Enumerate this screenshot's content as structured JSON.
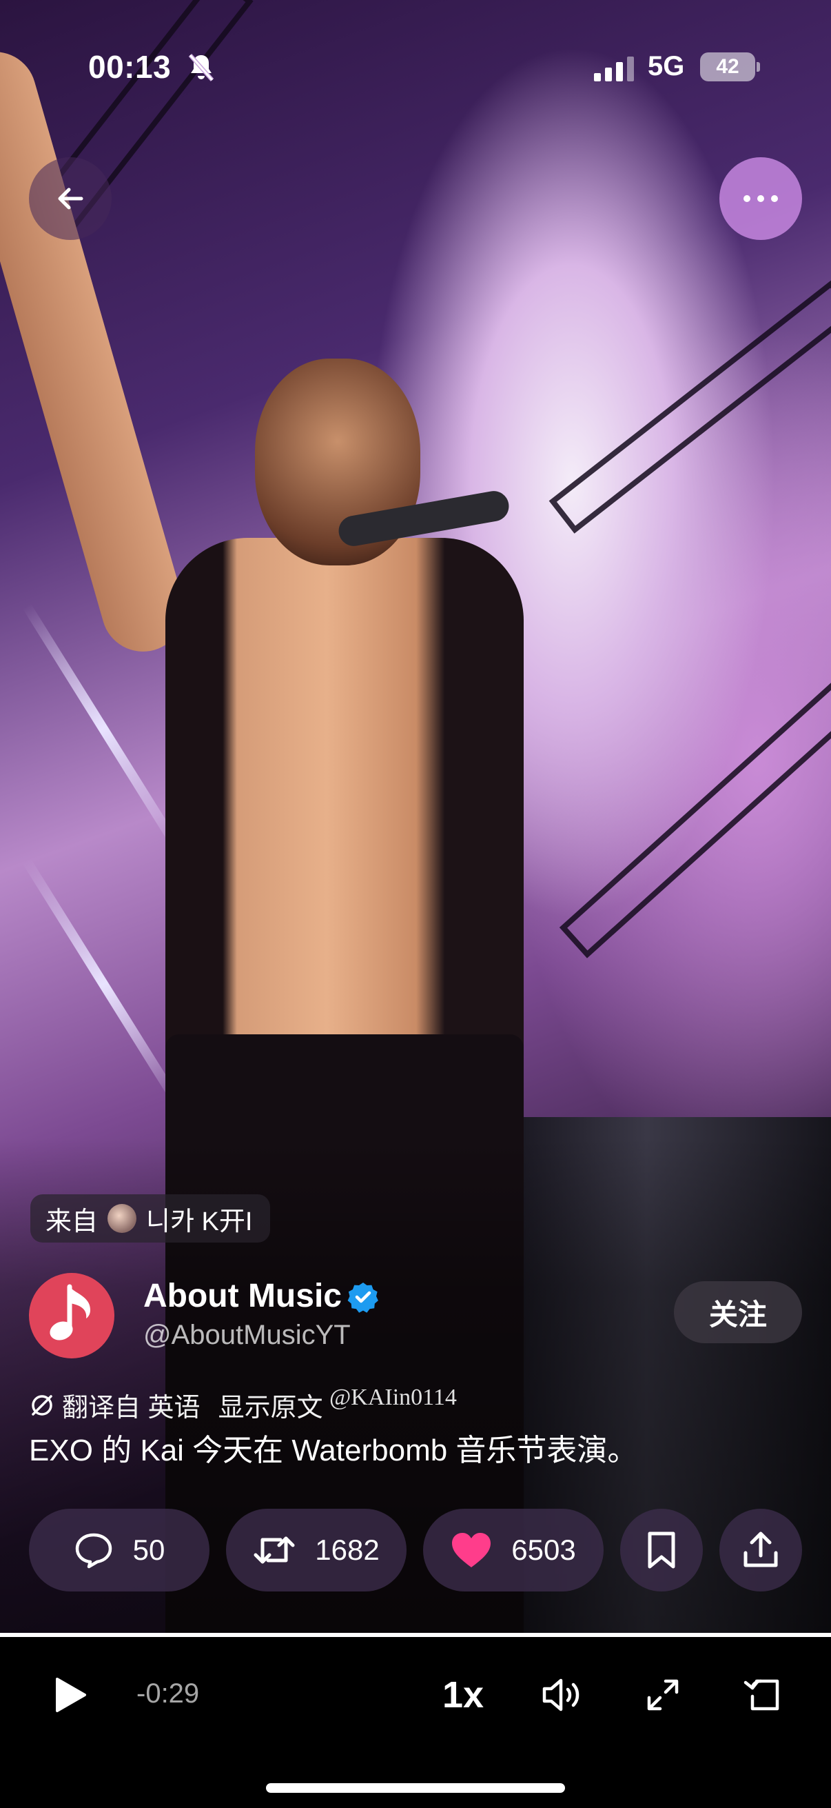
{
  "status_bar": {
    "time": "00:13",
    "network": "5G",
    "battery": "42",
    "icons": [
      "bell-muted-icon",
      "signal-icon",
      "battery-icon"
    ]
  },
  "top_bar": {
    "back_icon": "arrow-left-icon",
    "more_icon": "more-dots-icon"
  },
  "source": {
    "prefix": "来自",
    "name": "니카 K开I"
  },
  "author": {
    "name": "About Music",
    "handle": "@AboutMusicYT",
    "verified": true,
    "avatar_icon": "music-note-icon",
    "follow_label": "关注"
  },
  "caption": {
    "translate_label": "翻译自 英语",
    "show_original_label": "显示原文",
    "watermark": "@KAIin0114",
    "text": "EXO 的 Kai 今天在 Waterbomb 音乐节表演。"
  },
  "actions": {
    "replies": "50",
    "reposts": "1682",
    "likes": "6503",
    "liked": true
  },
  "player": {
    "time_remaining": "-0:29",
    "speed": "1x",
    "progress": 1.0
  },
  "colors": {
    "like": "#ff3d8b",
    "verified": "#1d9bf0",
    "avatar_bg": "#e0445a",
    "more_button": "#d08ce6"
  }
}
